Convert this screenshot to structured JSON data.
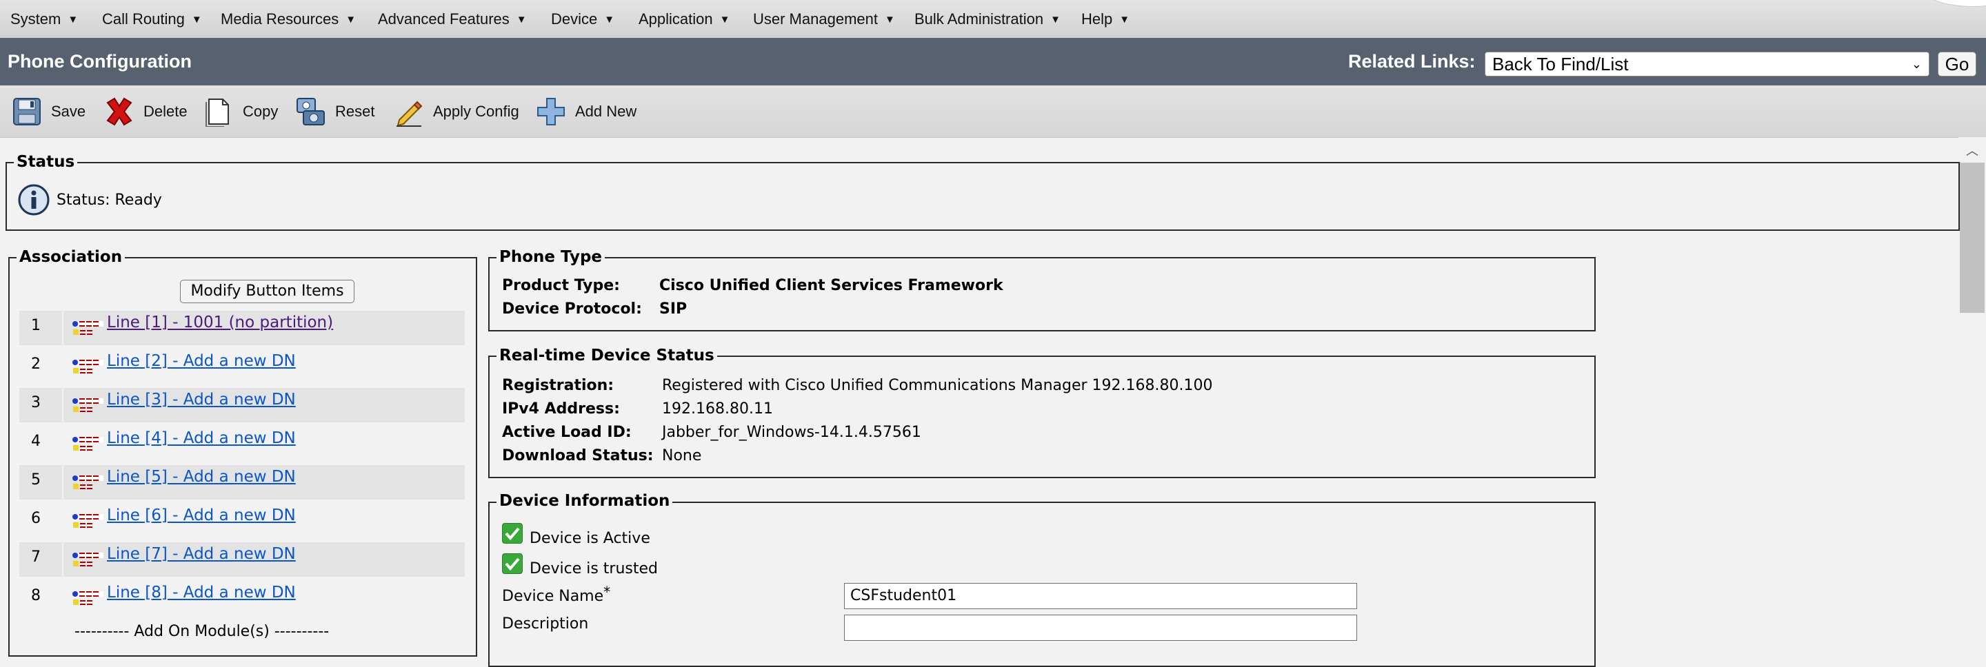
{
  "menu": [
    {
      "label": "System"
    },
    {
      "label": "Call Routing"
    },
    {
      "label": "Media Resources"
    },
    {
      "label": "Advanced Features"
    },
    {
      "label": "Device"
    },
    {
      "label": "Application"
    },
    {
      "label": "User Management"
    },
    {
      "label": "Bulk Administration"
    },
    {
      "label": "Help"
    }
  ],
  "header": {
    "title": "Phone Configuration",
    "related_links_label": "Related Links:",
    "related_links_value": "Back To Find/List",
    "go_label": "Go"
  },
  "toolbar": {
    "save": "Save",
    "delete": "Delete",
    "copy": "Copy",
    "reset": "Reset",
    "apply_config": "Apply Config",
    "add_new": "Add New"
  },
  "status": {
    "legend": "Status",
    "text": "Status: Ready"
  },
  "association": {
    "legend": "Association",
    "modify_button": "Modify Button Items",
    "lines": [
      {
        "num": "1",
        "label": "Line [1] - 1001 (no partition)"
      },
      {
        "num": "2",
        "label": "Line [2] - Add a new DN"
      },
      {
        "num": "3",
        "label": "Line [3] - Add a new DN"
      },
      {
        "num": "4",
        "label": "Line [4] - Add a new DN"
      },
      {
        "num": "5",
        "label": "Line [5] - Add a new DN"
      },
      {
        "num": "6",
        "label": "Line [6] - Add a new DN"
      },
      {
        "num": "7",
        "label": "Line [7] - Add a new DN"
      },
      {
        "num": "8",
        "label": "Line [8] - Add a new DN"
      }
    ],
    "addon_label": "---------- Add On Module(s) ----------"
  },
  "phone_type": {
    "legend": "Phone Type",
    "product_type_label": "Product Type:",
    "product_type_value": "Cisco Unified Client Services Framework",
    "device_protocol_label": "Device Protocol:",
    "device_protocol_value": "SIP"
  },
  "realtime": {
    "legend": "Real-time Device Status",
    "registration_label": "Registration:",
    "registration_value": "Registered with Cisco Unified Communications Manager 192.168.80.100",
    "ipv4_label": "IPv4 Address:",
    "ipv4_value": "192.168.80.11",
    "load_label": "Active Load ID:",
    "load_value": "Jabber_for_Windows-14.1.4.57561",
    "download_label": "Download Status:",
    "download_value": "None"
  },
  "device_info": {
    "legend": "Device Information",
    "active_label": "Device is Active",
    "active_checked": true,
    "trusted_label": "Device is trusted",
    "trusted_checked": true,
    "device_name_label": "Device Name",
    "required_mark": "*",
    "device_name_value": "CSFstudent01",
    "description_label": "Description",
    "description_value": ""
  },
  "colors": {
    "title_bar": "#57616f",
    "link": "#0b55c4",
    "visited_link": "#4b1a7a",
    "check_green": "#3aa93a"
  }
}
